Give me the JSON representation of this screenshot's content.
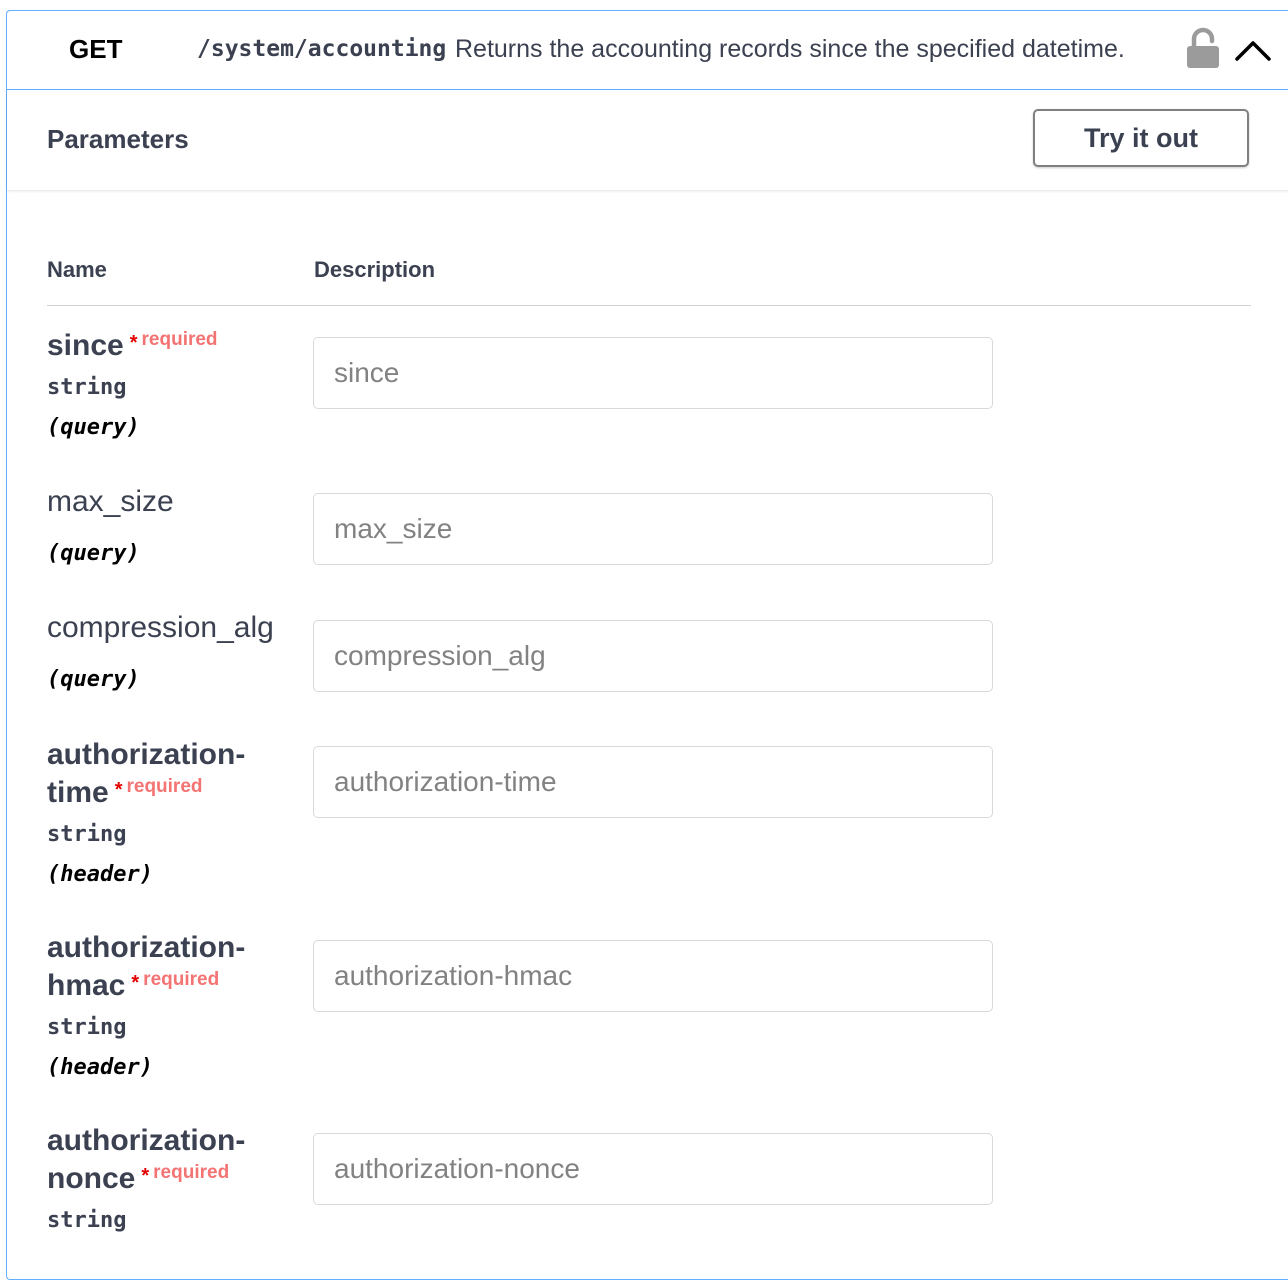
{
  "operation": {
    "method": "GET",
    "path": "/system/accounting",
    "summary": "Returns the accounting records since the specified datetime."
  },
  "icons": {
    "lock": "unlocked-padlock-icon",
    "toggle": "chevron-up-icon"
  },
  "section": {
    "title": "Parameters",
    "try_label": "Try it out"
  },
  "columns": {
    "name": "Name",
    "description": "Description"
  },
  "required_star": "*",
  "required_label": "required",
  "params": [
    {
      "name": "since",
      "required": true,
      "type": "string",
      "in": "(query)",
      "placeholder": "since"
    },
    {
      "name": "max_size",
      "required": false,
      "type": "",
      "in": "(query)",
      "placeholder": "max_size"
    },
    {
      "name": "compression_alg",
      "required": false,
      "type": "",
      "in": "(query)",
      "placeholder": "compression_alg"
    },
    {
      "name_line1": "authorization-",
      "name_line2": "time",
      "required": true,
      "type": "string",
      "in": "(header)",
      "placeholder": "authorization-time"
    },
    {
      "name_line1": "authorization-",
      "name_line2": "hmac",
      "required": true,
      "type": "string",
      "in": "(header)",
      "placeholder": "authorization-hmac"
    },
    {
      "name_line1": "authorization-",
      "name_line2": "nonce",
      "required": true,
      "type": "string",
      "placeholder": "authorization-nonce"
    }
  ],
  "colors": {
    "accent_border": "#61affe",
    "required_star": "#e30000",
    "required_text": "#f47373",
    "text": "#3b4151"
  }
}
